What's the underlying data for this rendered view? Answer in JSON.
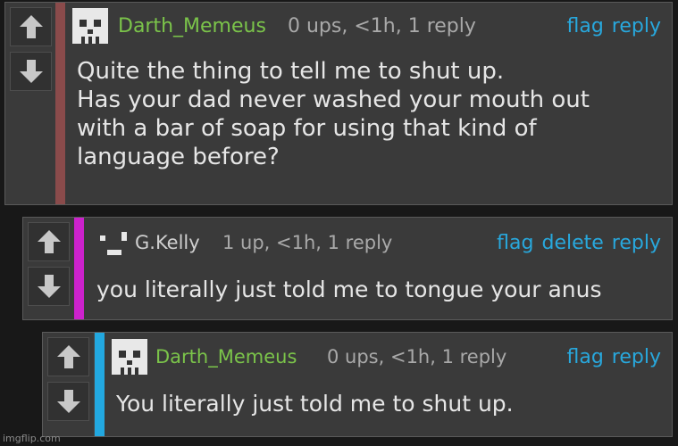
{
  "comments": [
    {
      "username": "Darth_Memeus",
      "meta": "0 ups, <1h, 1 reply",
      "actions": [
        "flag",
        "reply"
      ],
      "lines": [
        "Quite the thing to tell me to shut up.",
        "Has your dad never washed your mouth out",
        "with a bar of soap for using that kind of",
        "language before?"
      ],
      "bar_color": "#8a4b4b",
      "avatar": "skull-avatar-icon"
    },
    {
      "username": "G.Kelly",
      "meta": "1 up, <1h, 1 reply",
      "actions": [
        "flag",
        "delete",
        "reply"
      ],
      "lines": [
        "you literally just told me to tongue your anus"
      ],
      "bar_color": "#cc22cc",
      "avatar": "face-avatar-icon"
    },
    {
      "username": "Darth_Memeus",
      "meta": "0 ups, <1h, 1 reply",
      "actions": [
        "flag",
        "reply"
      ],
      "lines": [
        "You literally just told me to shut up."
      ],
      "bar_color": "#22a8e0",
      "avatar": "skull-avatar-icon"
    }
  ],
  "watermark": "imgflip.com",
  "colors": {
    "link": "#28a8dd",
    "username": "#7bc44a"
  },
  "icons": [
    "upvote-arrow-icon",
    "downvote-arrow-icon"
  ]
}
